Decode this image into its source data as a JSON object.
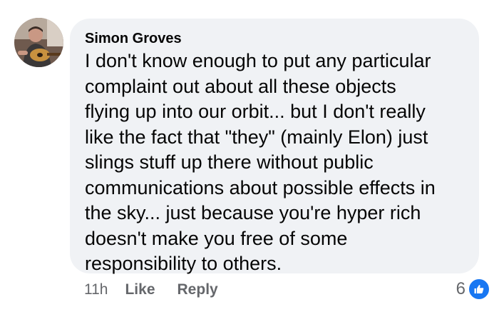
{
  "comment": {
    "author": "Simon Groves",
    "lines": [
      "I don't know enough to put any particular",
      "complaint out about all these objects",
      "flying up into our orbit... but I don't really",
      "like the fact that \"they\" (mainly Elon) just",
      "slings stuff up there without public",
      "communications about possible effects in",
      "the sky... just because you're hyper rich",
      "doesn't make you free of some",
      "responsibility to others."
    ],
    "timestamp": "11h",
    "like_label": "Like",
    "reply_label": "Reply",
    "reaction_count": "6",
    "reaction_icon": "thumbs-up-icon"
  },
  "colors": {
    "bubble_bg": "#f0f2f5",
    "secondary_text": "#65676b",
    "like_blue": "#1877f2"
  }
}
